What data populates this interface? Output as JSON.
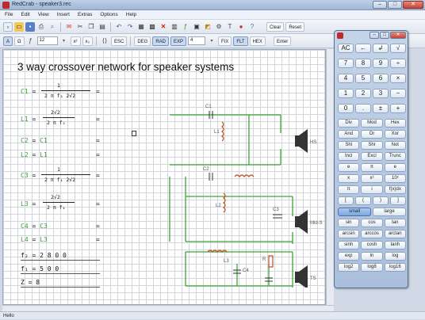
{
  "window": {
    "title": "RedCrab - speaker3.rec",
    "minimize": "–",
    "maximize": "□",
    "close": "✕"
  },
  "menu": [
    "File",
    "Edit",
    "View",
    "Insert",
    "Extras",
    "Options",
    "Help"
  ],
  "toolbar1": {
    "clear": "Clear",
    "reset": "Reset"
  },
  "toolbar2": {
    "font_a": "A",
    "omega": "Ω",
    "font_size": "12",
    "x2": "x²",
    "x3": "x₃",
    "esc": "ESC",
    "deg": "DEG",
    "rad": "RAD",
    "exp": "EXP",
    "exp_value": "4",
    "fix": "FIX",
    "flt": "FLT",
    "hex": "HEX",
    "enter": "Enter"
  },
  "sheet": {
    "heading": "3 way crossover network for speaker systems",
    "equations": [
      {
        "lhs": "C1",
        "sign": "=",
        "result": "="
      },
      {
        "lhs": "L1",
        "sign": "=",
        "result": "="
      },
      {
        "lhs": "C2",
        "sign": "=",
        "rhs": "C1",
        "result": "="
      },
      {
        "lhs": "L2",
        "sign": "=",
        "rhs": "L1",
        "result": "="
      },
      {
        "lhs": "C3",
        "sign": "=",
        "result": "="
      },
      {
        "lhs": "L3",
        "sign": "=",
        "result": "="
      },
      {
        "lhs": "C4",
        "sign": "=",
        "rhs": "C3",
        "result": "="
      },
      {
        "lhs": "L4",
        "sign": "=",
        "rhs": "L3",
        "result": "="
      }
    ],
    "fractions": {
      "c1_num": "1",
      "c1_den": "2 π f₂ 2√2",
      "l1_num": "2√2",
      "l1_den": "2 π f₂",
      "c3_num": "1",
      "c3_den": "2 π f₁ 2√2",
      "l3_num": "2√2",
      "l3_den": "2 π f₁"
    },
    "params": [
      {
        "text": "f₂ = 2 8 0 0"
      },
      {
        "text": "f₁ = 5 0 0"
      },
      {
        "text": "Z = 8"
      }
    ],
    "circuit_labels": {
      "c1": "C1",
      "l1": "L1",
      "c2": "C2",
      "l2": "L2",
      "l3": "L3",
      "c3": "C3",
      "c4": "C4",
      "r": "R",
      "hs": "HS",
      "ms": "Mid-S",
      "ts": "TS"
    }
  },
  "status": {
    "text": "Hello"
  },
  "calculator": {
    "rows": [
      [
        "AC",
        "←",
        "↲",
        "√"
      ],
      [
        "7",
        "8",
        "9",
        "÷"
      ],
      [
        "4",
        "5",
        "6",
        "×"
      ],
      [
        "1",
        "2",
        "3",
        "−"
      ],
      [
        "0",
        ".",
        "±",
        "+"
      ],
      [
        "Div",
        "Mod",
        "Hex"
      ],
      [
        "And",
        "Or",
        "Xor"
      ],
      [
        "Shl",
        "Shr",
        "Not"
      ],
      [
        "Incl",
        "Excl",
        "Trunc"
      ],
      [
        "e",
        "π",
        "e"
      ],
      [
        "x",
        "x²",
        "10ˣ"
      ],
      [
        "π",
        "i",
        "f(x)dx"
      ],
      [
        "[",
        "(",
        ")",
        "]"
      ],
      [
        "small",
        "large"
      ],
      [
        "sin",
        "cos",
        "tan"
      ],
      [
        "arcsin",
        "arccos",
        "arctan"
      ],
      [
        "sinh",
        "cosh",
        "tanh"
      ],
      [
        "exp",
        "ln",
        "log"
      ],
      [
        "log2",
        "log8",
        "log16"
      ]
    ]
  }
}
